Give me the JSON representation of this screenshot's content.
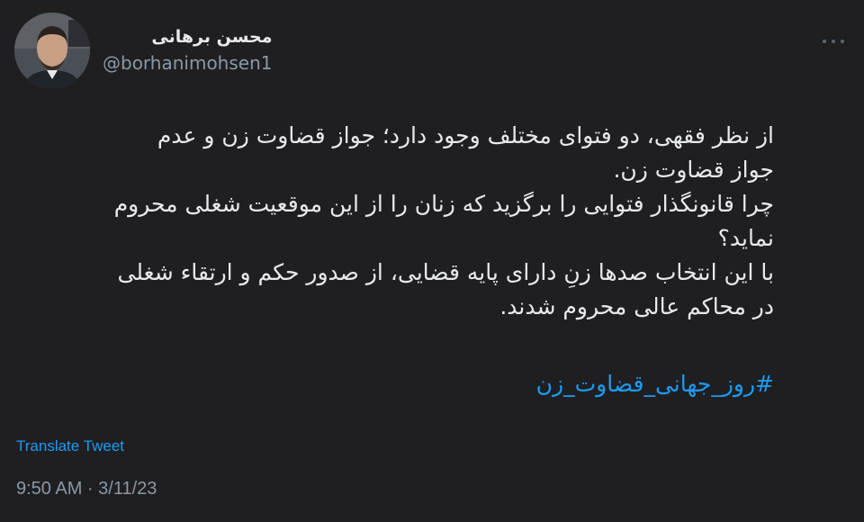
{
  "author": {
    "display_name": "محسن برهانی",
    "handle": "@borhanimohsen1",
    "avatar": "profile-photo"
  },
  "more_icon": "more-horizontal-icon",
  "body_lines": [
    "از نظر فقهی، دو فتوای مختلف وجود دارد؛ جواز قضاوت زن و عدم",
    "جواز قضاوت زن.",
    "چرا قانونگذار فتوایی را برگزید که زنان را از این موقعیت شغلی محروم",
    "نماید؟",
    "با این انتخاب صدها زنِ دارای پایه قضایی، از صدور حکم و ارتقاء شغلی",
    "در محاکم عالی محروم شدند."
  ],
  "hashtag": "#روز_جهانی_قضاوت_زن",
  "translate_label": "Translate Tweet",
  "timestamp": "9:50 AM · 3/11/23",
  "colors": {
    "background": "#1f1f22",
    "text": "#e7e9ea",
    "secondary_text": "#8b98a5",
    "link": "#1d9bf0"
  }
}
